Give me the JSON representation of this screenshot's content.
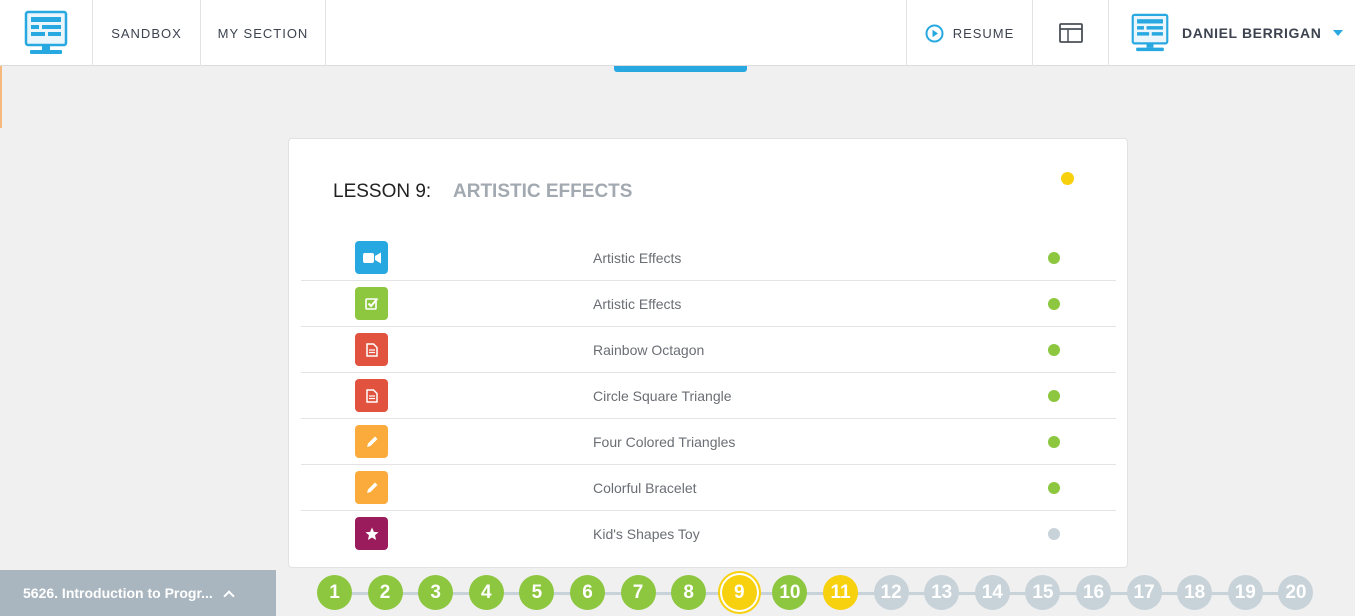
{
  "nav": {
    "sandbox": "SANDBOX",
    "my_section": "MY SECTION",
    "resume": "RESUME",
    "user_name": "DANIEL BERRIGAN"
  },
  "colors": {
    "accent": "#28a8e0",
    "complete": "#8dc63f",
    "in_progress": "#f7d10d",
    "locked": "#c7d2d9"
  },
  "lesson": {
    "number_label": "LESSON 9:",
    "title": "ARTISTIC EFFECTS",
    "status": "in-progress",
    "items": [
      {
        "label": "Artistic Effects",
        "icon": "video-icon",
        "icon_color": "#28a8e0",
        "status": "complete"
      },
      {
        "label": "Artistic Effects",
        "icon": "checkbox-icon",
        "icon_color": "#8dc63f",
        "status": "complete"
      },
      {
        "label": "Rainbow Octagon",
        "icon": "document-icon",
        "icon_color": "#e1533f",
        "status": "complete"
      },
      {
        "label": "Circle Square Triangle",
        "icon": "document-icon",
        "icon_color": "#e1533f",
        "status": "complete"
      },
      {
        "label": "Four Colored Triangles",
        "icon": "pencil-icon",
        "icon_color": "#fbab3c",
        "status": "complete"
      },
      {
        "label": "Colorful Bracelet",
        "icon": "pencil-icon",
        "icon_color": "#fbab3c",
        "status": "complete"
      },
      {
        "label": "Kid's Shapes Toy",
        "icon": "star-icon",
        "icon_color": "#9b1c5c",
        "status": "not-started"
      }
    ]
  },
  "course": {
    "label": "5626. Introduction to Progr..."
  },
  "lessons_nav": [
    {
      "n": "1",
      "status": "complete"
    },
    {
      "n": "2",
      "status": "complete"
    },
    {
      "n": "3",
      "status": "complete"
    },
    {
      "n": "4",
      "status": "complete"
    },
    {
      "n": "5",
      "status": "complete"
    },
    {
      "n": "6",
      "status": "complete"
    },
    {
      "n": "7",
      "status": "complete"
    },
    {
      "n": "8",
      "status": "complete"
    },
    {
      "n": "9",
      "status": "current"
    },
    {
      "n": "10",
      "status": "complete"
    },
    {
      "n": "11",
      "status": "in-progress"
    },
    {
      "n": "12",
      "status": "locked"
    },
    {
      "n": "13",
      "status": "locked"
    },
    {
      "n": "14",
      "status": "locked"
    },
    {
      "n": "15",
      "status": "locked"
    },
    {
      "n": "16",
      "status": "locked"
    },
    {
      "n": "17",
      "status": "locked"
    },
    {
      "n": "18",
      "status": "locked"
    },
    {
      "n": "19",
      "status": "locked"
    },
    {
      "n": "20",
      "status": "locked"
    }
  ]
}
